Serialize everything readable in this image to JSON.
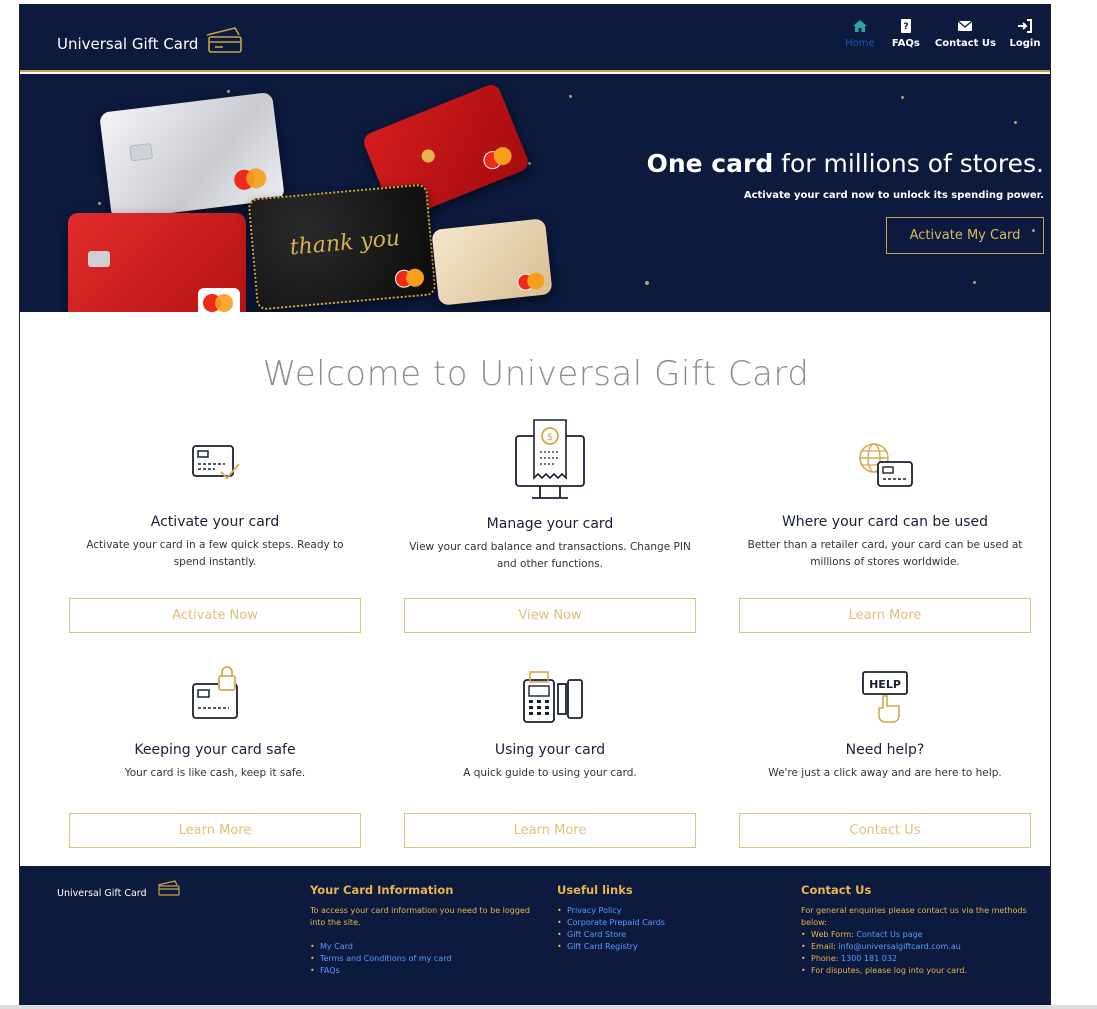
{
  "header": {
    "brand": "Universal Gift Card",
    "nav": [
      {
        "label": "Home",
        "icon": "home-icon"
      },
      {
        "label": "FAQs",
        "icon": "faq-icon"
      },
      {
        "label": "Contact Us",
        "icon": "envelope-icon"
      },
      {
        "label": "Login",
        "icon": "login-icon"
      }
    ]
  },
  "hero": {
    "title_bold": "One card",
    "title_rest": "for millions of stores.",
    "subtitle": "Activate your card now to unlock its spending power.",
    "button": "Activate My Card",
    "card_text": "thank you"
  },
  "welcome": "Welcome to Universal Gift Card",
  "features": [
    {
      "title": "Activate your card",
      "desc": "Activate your card in a few quick steps. Ready to spend instantly.",
      "button": "Activate Now"
    },
    {
      "title": "Manage your card",
      "desc": "View your card balance and transactions. Change PIN and other functions.",
      "button": "View Now"
    },
    {
      "title": "Where your card can be used",
      "desc": "Better than a retailer card, your card can be used at millions of stores worldwide.",
      "button": "Learn More"
    },
    {
      "title": "Keeping your card safe",
      "desc": "Your card is like cash, keep it safe.",
      "button": "Learn More"
    },
    {
      "title": "Using your card",
      "desc": "A quick guide to using your card.",
      "button": "Learn More"
    },
    {
      "title": "Need help?",
      "desc": "We're just a click away and are here to help.",
      "button": "Contact Us"
    }
  ],
  "help_sign": "HELP",
  "footer": {
    "brand": "Universal Gift Card",
    "card_info": {
      "heading": "Your Card Information",
      "text": "To access your card information you need to be logged into the site.",
      "links": [
        "My Card",
        "Terms and Conditions of my card",
        "FAQs"
      ]
    },
    "useful_links": {
      "heading": "Useful links",
      "links": [
        "Privacy Policy",
        "Corporate Prepaid Cards",
        "Gift Card Store",
        "Gift Card Registry"
      ]
    },
    "contact": {
      "heading": "Contact Us",
      "text": "For general enquiries please contact us via the methods below:",
      "web_label": "Web Form:",
      "web_link": "Contact Us page",
      "email_label": "Email:",
      "email": "info@universalgiftcard.com.au",
      "phone_label": "Phone:",
      "phone": "1300 181 032",
      "disputes": "For disputes, please log into your card."
    }
  },
  "colors": {
    "navy": "#0b1a3d",
    "gold": "#c8a44a",
    "accent_blue": "#1e5bb8"
  }
}
